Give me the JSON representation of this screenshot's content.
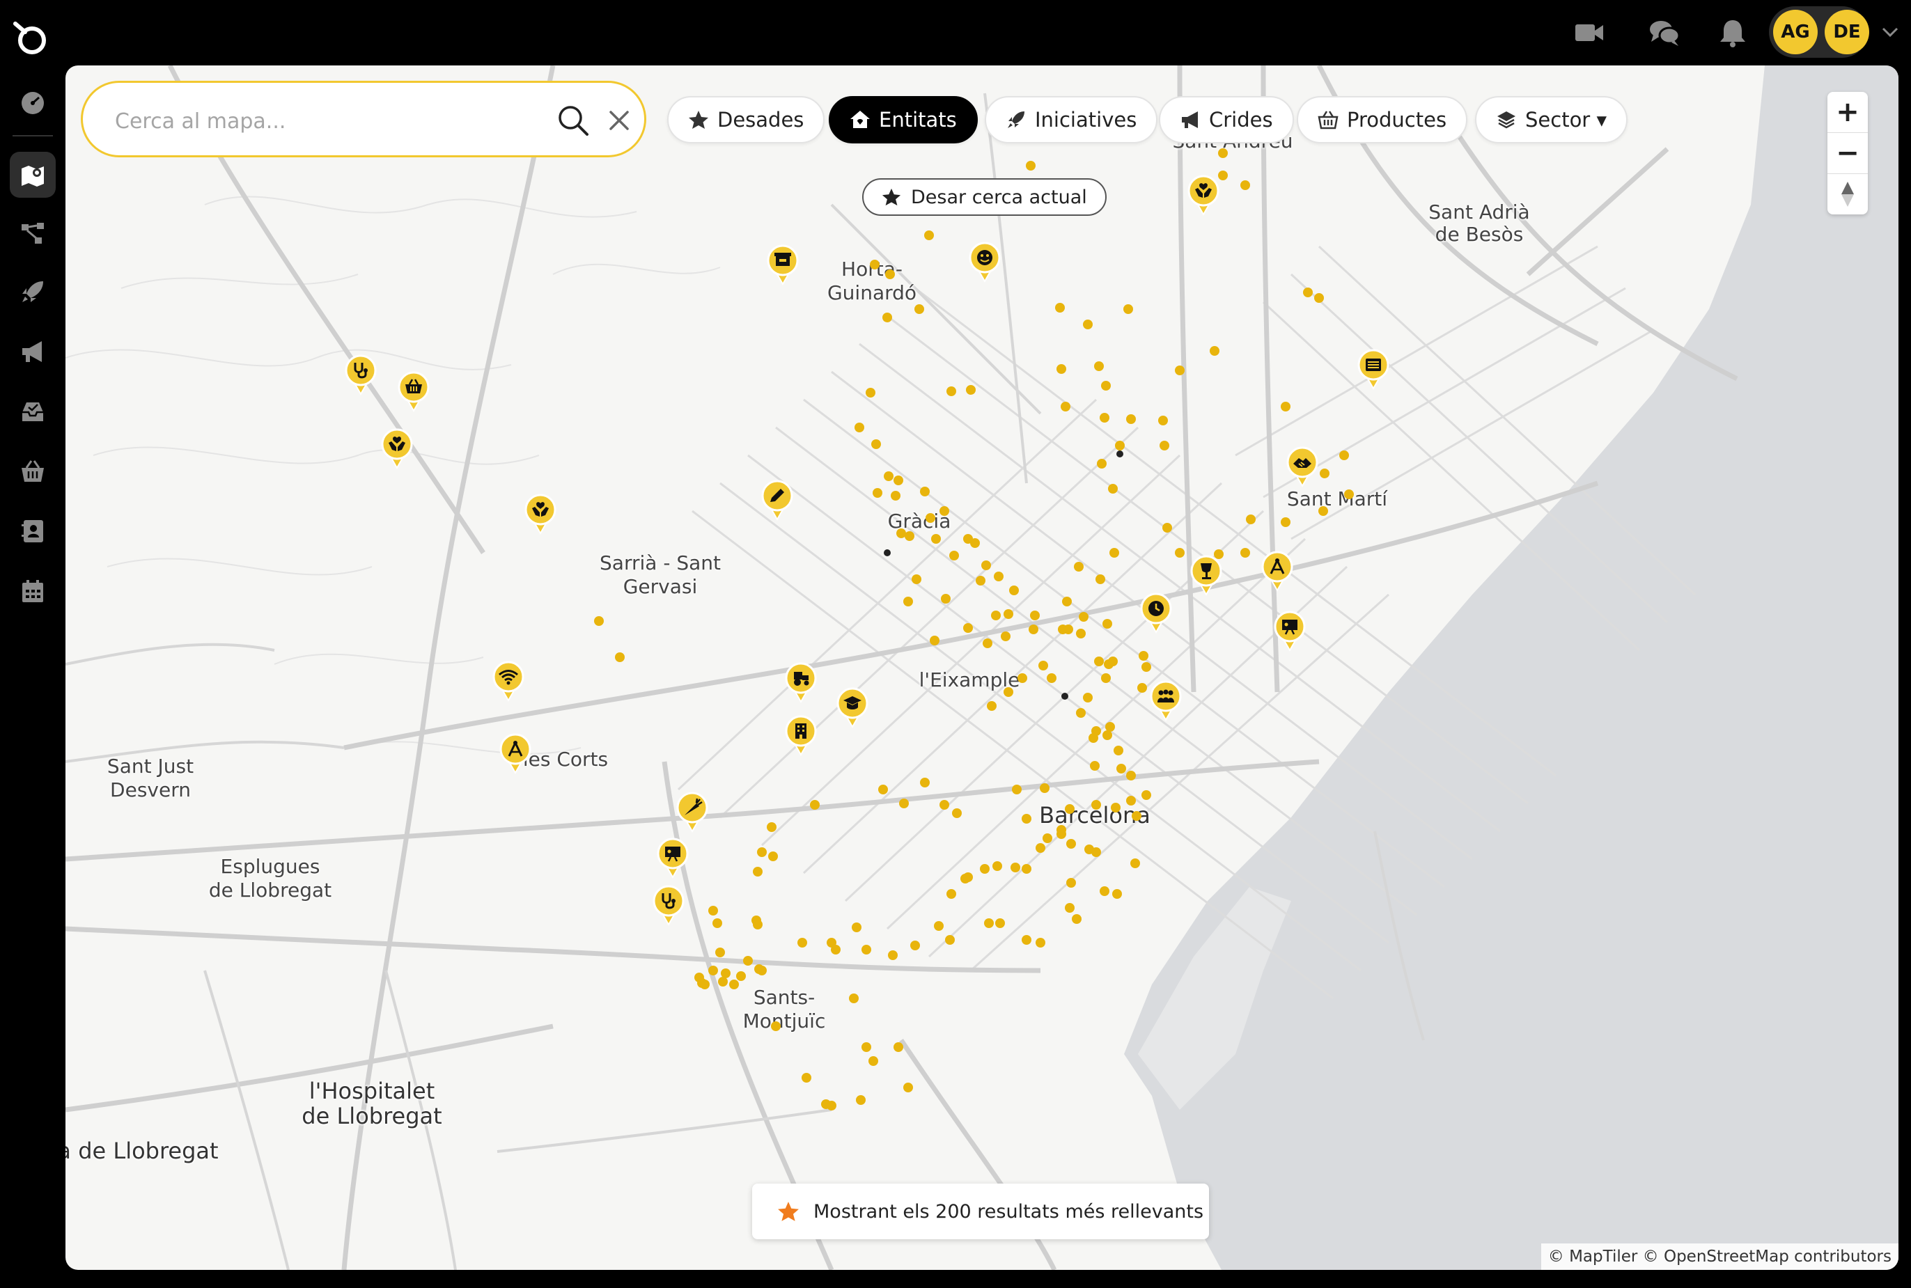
{
  "topbar": {
    "icons": [
      "logo-icon",
      "video-icon",
      "chat-icon",
      "bell-icon",
      "chevron-down-icon"
    ],
    "avatars": [
      "AG",
      "DE"
    ]
  },
  "sidebar": {
    "items": [
      "dashboard-icon",
      "map-icon",
      "network-icon",
      "rocket-icon",
      "megaphone-icon",
      "inbox-icon",
      "basket-icon",
      "contacts-icon",
      "calendar-icon"
    ],
    "active": "map-icon"
  },
  "search": {
    "placeholder": "Cerca al mapa..."
  },
  "filters": [
    {
      "label": "Desades",
      "icon": "star-icon"
    },
    {
      "label": "Entitats",
      "icon": "home-icon",
      "active": true
    },
    {
      "label": "Iniciatives",
      "icon": "rocket-icon"
    },
    {
      "label": "Crides",
      "icon": "megaphone-icon"
    },
    {
      "label": "Productes",
      "icon": "basket-icon"
    },
    {
      "label": "Sector ▾",
      "icon": "layers-icon"
    }
  ],
  "save_search": {
    "label": "Desar cerca actual",
    "icon": "star-icon"
  },
  "zoom": {
    "in": "+",
    "out": "−"
  },
  "places": {
    "sant_andreu": "Sant Andreu",
    "sant_adria_1": "Sant Adrià",
    "sant_adria_2": "de Besòs",
    "horta_1": "Horta-",
    "horta_2": "Guinardó",
    "gracia": "Gràcia",
    "sarria_1": "Sarrià - Sant",
    "sarria_2": "Gervasi",
    "sant_marti": "Sant Martí",
    "eixample": "l'Eixample",
    "les_corts": "les Corts",
    "sant_just_1": "Sant Just",
    "sant_just_2": "Desvern",
    "esplugues_1": "Esplugues",
    "esplugues_2": "de Llobregat",
    "barcelona": "Barcelona",
    "sants_1": "Sants-",
    "sants_2": "Montjuïc",
    "hospitalet_1": "l'Hospitalet",
    "hospitalet_2": "de Llobregat",
    "cornella": "à de Llobregat"
  },
  "results_note": {
    "text": "Mostrant els 200 resultats més rellevants",
    "icon": "star-icon",
    "icon_color": "#f07c1e"
  },
  "attribution": "© MapTiler © OpenStreetMap contributors",
  "colors": {
    "accent": "#f2c82f",
    "marker": "#f2c82f",
    "dot": "#e8b40c"
  },
  "markers": [
    {
      "icon": "store-icon"
    },
    {
      "icon": "theater-icon"
    },
    {
      "icon": "hands-heart-icon"
    },
    {
      "icon": "stethoscope-icon"
    },
    {
      "icon": "basket-icon"
    },
    {
      "icon": "hands-heart-icon"
    },
    {
      "icon": "hands-heart-icon"
    },
    {
      "icon": "pencil-icon"
    },
    {
      "icon": "list-icon"
    },
    {
      "icon": "handshake-icon"
    },
    {
      "icon": "glass-icon"
    },
    {
      "icon": "compass-icon"
    },
    {
      "icon": "clock-icon"
    },
    {
      "icon": "presentation-icon"
    },
    {
      "icon": "wifi-icon"
    },
    {
      "icon": "tractor-icon"
    },
    {
      "icon": "cap-icon"
    },
    {
      "icon": "building-icon"
    },
    {
      "icon": "people-icon"
    },
    {
      "icon": "compass-icon"
    },
    {
      "icon": "carrot-icon"
    },
    {
      "icon": "presentation-icon"
    },
    {
      "icon": "stethoscope-icon"
    }
  ]
}
